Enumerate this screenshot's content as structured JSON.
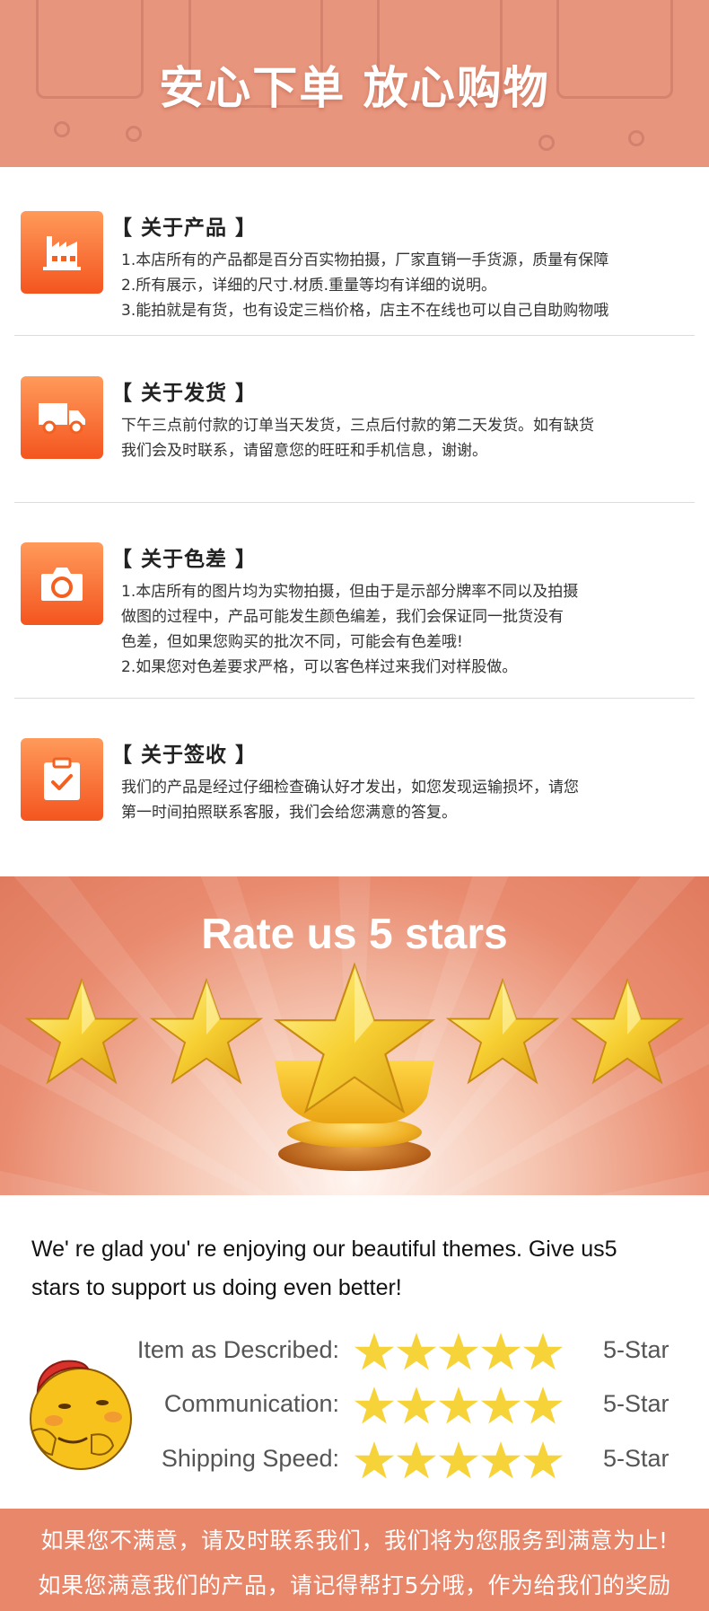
{
  "banner": {
    "title": "安心下单 放心购物"
  },
  "sections": [
    {
      "title": "【 关于产品 】",
      "icon": "factory-icon",
      "lines": [
        "1.本店所有的产品都是百分百实物拍摄，厂家直销一手货源，质量有保障",
        "2.所有展示，详细的尺寸.材质.重量等均有详细的说明。",
        "3.能拍就是有货，也有设定三档价格，店主不在线也可以自己自助购物哦"
      ]
    },
    {
      "title": "【 关于发货 】",
      "icon": "truck-icon",
      "lines": [
        "下午三点前付款的订单当天发货，三点后付款的第二天发货。如有缺货",
        "我们会及时联系，请留意您的旺旺和手机信息，谢谢。"
      ]
    },
    {
      "title": "【 关于色差 】",
      "icon": "camera-icon",
      "lines": [
        "1.本店所有的图片均为实物拍摄，但由于是示部分牌率不同以及拍摄",
        "做图的过程中，产品可能发生颜色编差，我们会保证同一批货没有",
        "色差，但如果您购买的批次不同，可能会有色差哦!",
        "2.如果您对色差要求严格，可以客色样过来我们对样股做。"
      ]
    },
    {
      "title": "【 关于签收 】",
      "icon": "clipboard-check-icon",
      "lines": [
        "我们的产品是经过仔细检查确认好才发出，如您发现运输损坏，请您",
        "第一时间拍照联系客服，我们会给您满意的答复。"
      ]
    }
  ],
  "rate": {
    "title": "Rate us 5 stars",
    "stars": 5
  },
  "review": {
    "lines": [
      "We' re glad you' re enjoying our beautiful themes. Give us5",
      "stars to support us doing even better!"
    ],
    "ratings": [
      {
        "label": "Item as Described:",
        "stars": 5,
        "value": "5-Star"
      },
      {
        "label": "Communication:",
        "stars": 5,
        "value": "5-Star"
      },
      {
        "label": "Shipping Speed:",
        "stars": 5,
        "value": "5-Star"
      }
    ]
  },
  "footer": {
    "line1": "如果您不满意，请及时联系我们，我们将为您服务到满意为止!",
    "line2": "如果您满意我们的产品，请记得帮打5分哦，作为给我们的奖励"
  },
  "colors": {
    "accent": "#e9876b",
    "icon_top": "#ff9a5a",
    "icon_bottom": "#f4551f",
    "star": "#f7d33a"
  }
}
